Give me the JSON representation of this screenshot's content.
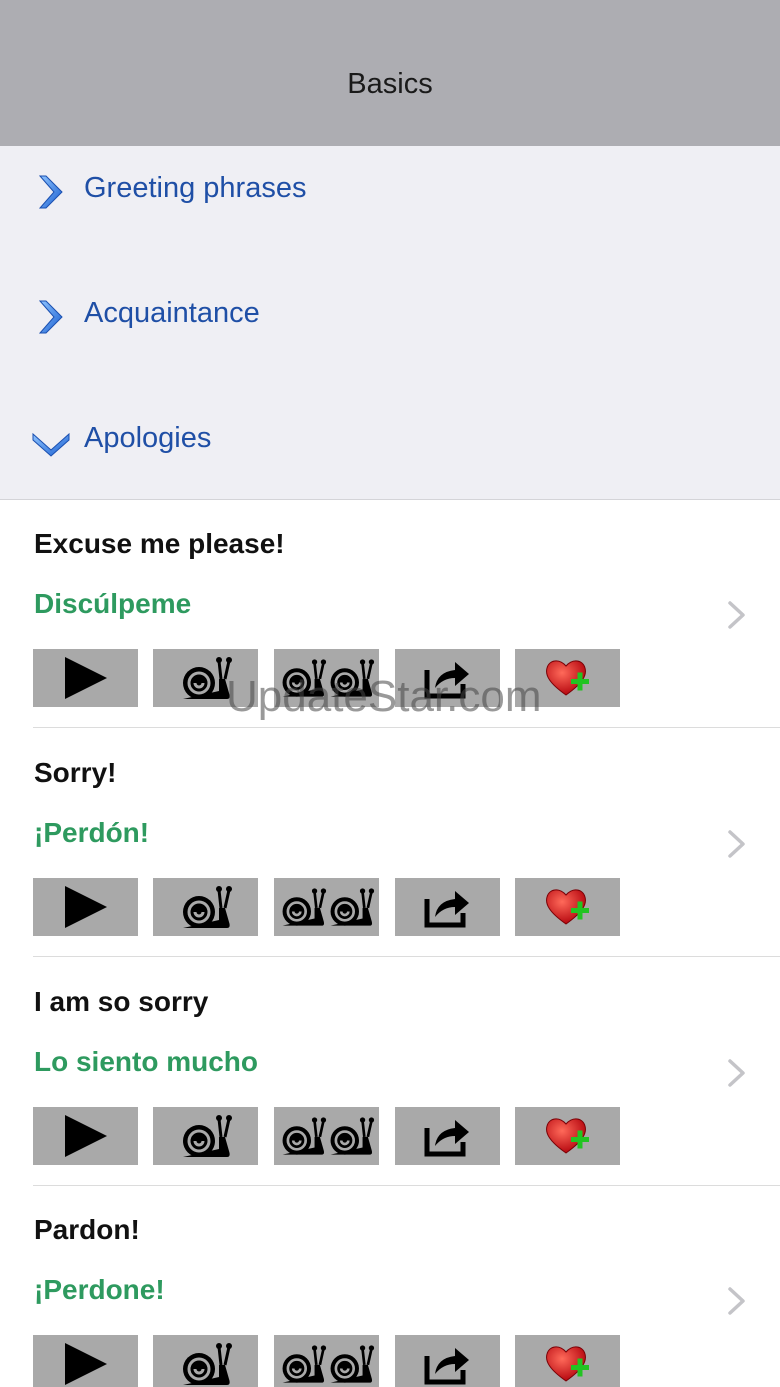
{
  "navbar": {
    "title": "Basics"
  },
  "sections": [
    {
      "label": "Greeting phrases",
      "state": "collapsed",
      "icon": "chevron-right-icon"
    },
    {
      "label": "Acquaintance",
      "state": "collapsed",
      "icon": "chevron-right-icon"
    },
    {
      "label": "Apologies",
      "state": "expanded",
      "icon": "chevron-down-icon"
    }
  ],
  "phrases": [
    {
      "english": "Excuse me please!",
      "spanish": "Discúlpeme"
    },
    {
      "english": "Sorry!",
      "spanish": "¡Perdón!"
    },
    {
      "english": "I am so sorry",
      "spanish": "Lo siento mucho"
    },
    {
      "english": "Pardon!",
      "spanish": "¡Perdone!"
    }
  ],
  "action_buttons": [
    {
      "name": "play-button",
      "icon": "play-icon"
    },
    {
      "name": "play-slow-button",
      "icon": "snail-icon"
    },
    {
      "name": "play-very-slow-button",
      "icon": "two-snails-icon"
    },
    {
      "name": "share-button",
      "icon": "share-icon"
    },
    {
      "name": "add-favorite-button",
      "icon": "heart-plus-icon"
    }
  ],
  "watermark": {
    "text": "UpdateStar.com"
  },
  "colors": {
    "navbar_bg": "#adadb2",
    "section_bg": "#efeff4",
    "section_text": "#1f4fa6",
    "spanish_text": "#2e9a5f",
    "button_bg": "#a9a9a9"
  }
}
